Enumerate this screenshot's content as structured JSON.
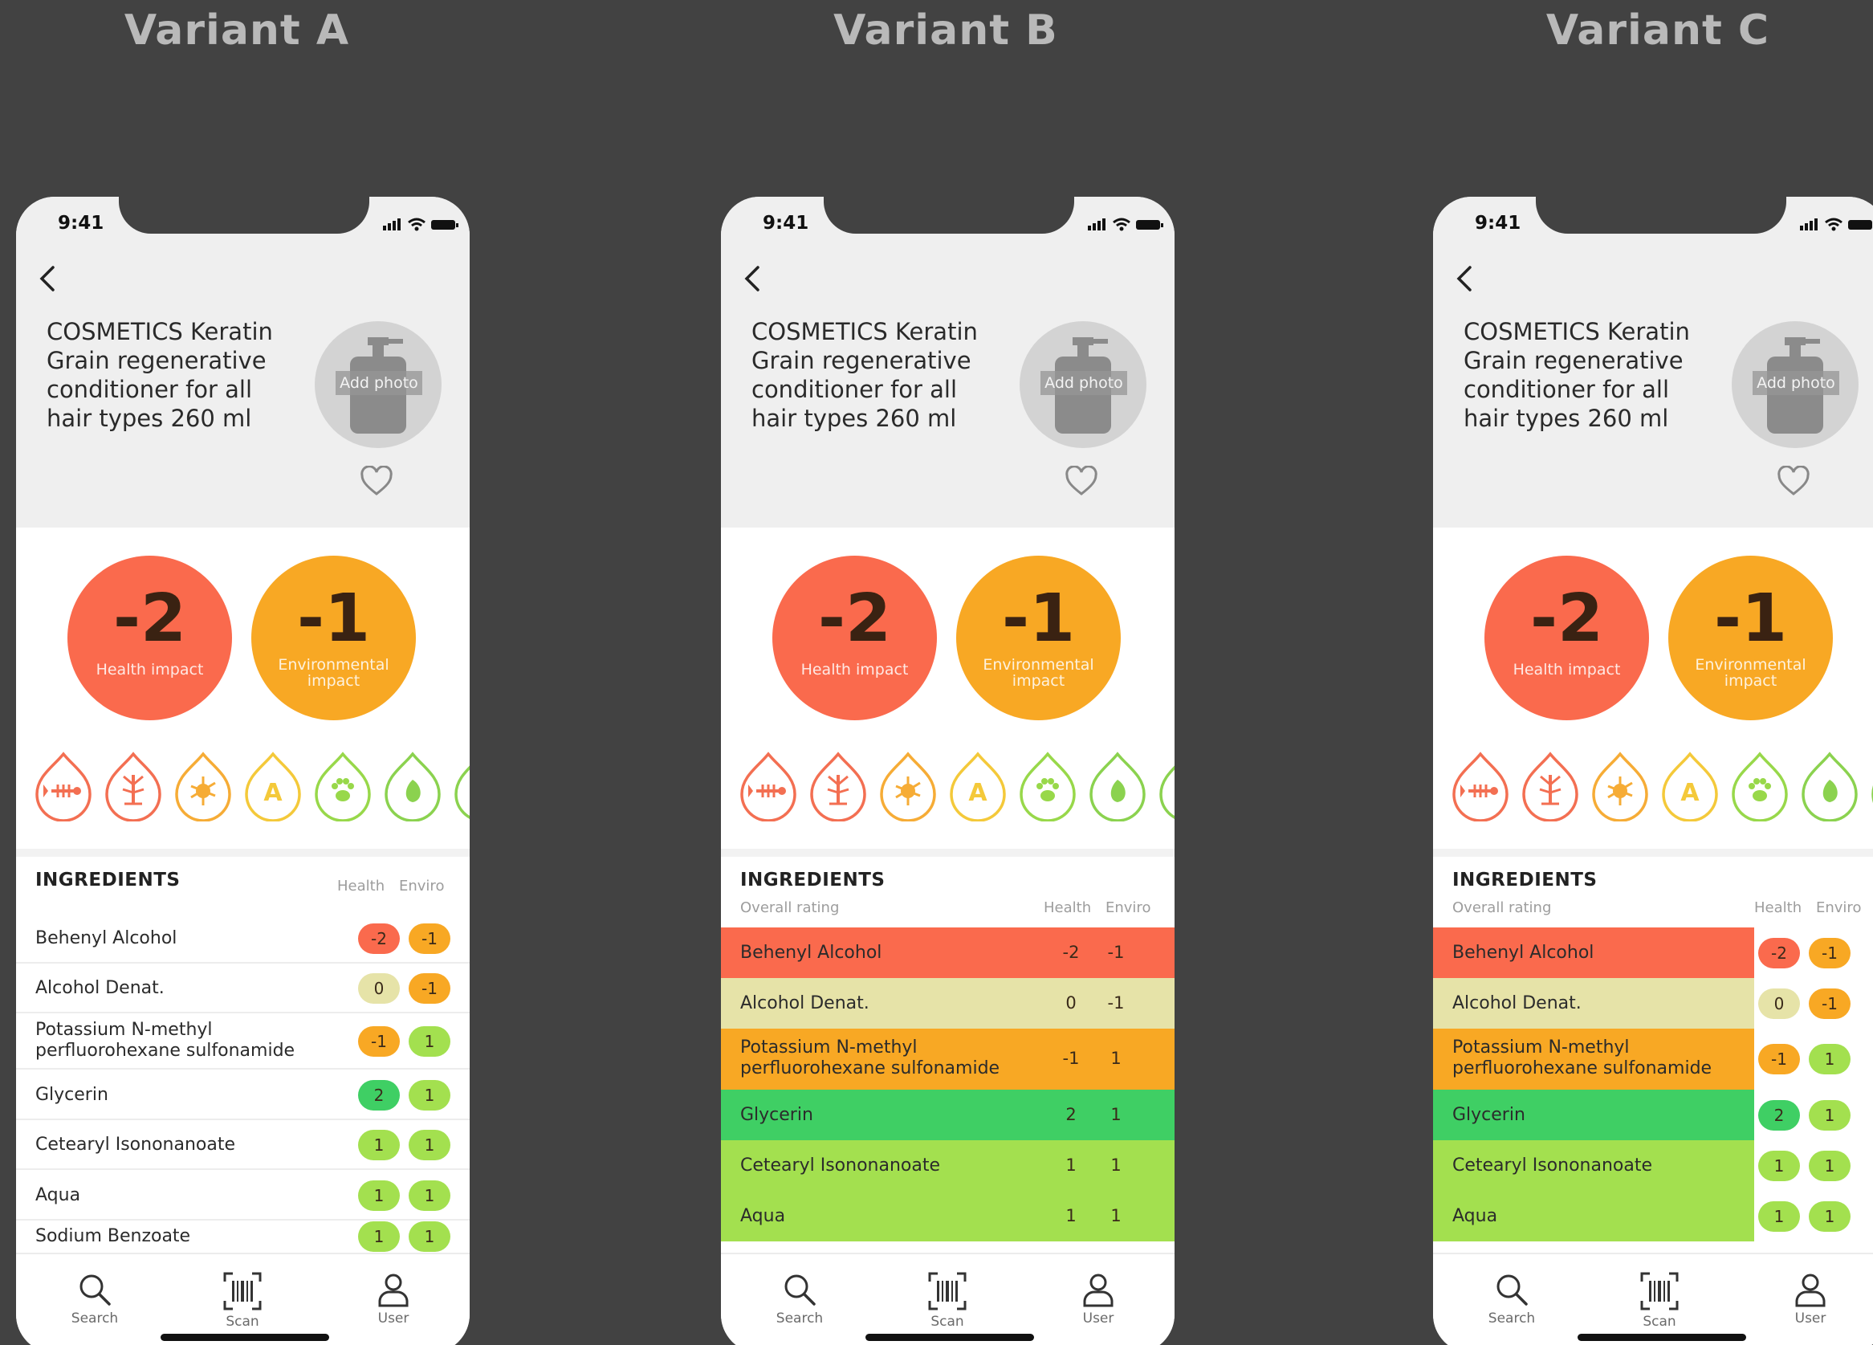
{
  "variant_titles": [
    "Variant A",
    "Variant B",
    "Variant C"
  ],
  "status_time": "9:41",
  "product": {
    "title": "COSMETICS Keratin Grain regenerative conditioner for all hair types 260 ml",
    "add_photo": "Add photo"
  },
  "scores": {
    "health": {
      "value": "-2",
      "label": "Health impact",
      "color": "#fa6a4d"
    },
    "enviro": {
      "value": "-1",
      "label": "Environmental impact",
      "color": "#f8a824"
    }
  },
  "impact_icons": [
    "fish-skeleton-icon",
    "dead-tree-icon",
    "microbe-icon",
    "letter-a-icon",
    "paw-icon",
    "leaf-icon"
  ],
  "ingredients": {
    "title": "INGREDIENTS",
    "overall_rating": "Overall rating",
    "col_health": "Health",
    "col_enviro": "Enviro",
    "items": [
      {
        "name": "Behenyl Alcohol",
        "health": "-2",
        "enviro": "-1"
      },
      {
        "name": "Alcohol Denat.",
        "health": "0",
        "enviro": "-1"
      },
      {
        "name": "Potassium N-methyl perfluorohexane sulfonamide",
        "health": "-1",
        "enviro": "1"
      },
      {
        "name": "Glycerin",
        "health": "2",
        "enviro": "1"
      },
      {
        "name": "Cetearyl Isononanoate",
        "health": "1",
        "enviro": "1"
      },
      {
        "name": "Aqua",
        "health": "1",
        "enviro": "1"
      },
      {
        "name": "Sodium Benzoate",
        "health": "1",
        "enviro": "1"
      }
    ]
  },
  "tabs": {
    "search": "Search",
    "scan": "Scan",
    "user": "User"
  },
  "colors": {
    "background": "#424242",
    "score_-2": "#fa6a4d",
    "score_-1": "#f8a824",
    "score_0": "#e6e3a8",
    "score_1": "#a3e04f",
    "score_2": "#3fcf64"
  }
}
